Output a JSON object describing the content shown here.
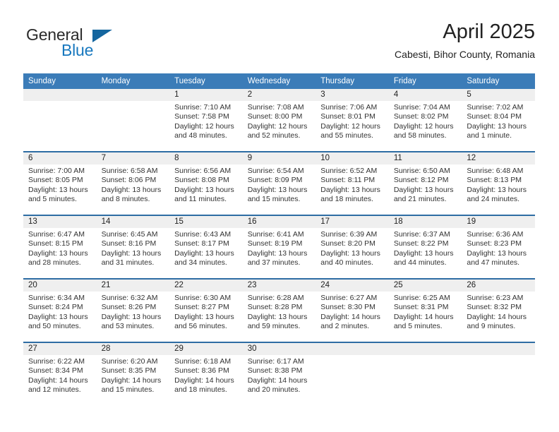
{
  "brand": {
    "name_part1": "General",
    "name_part2": "Blue",
    "triangle_color": "#15669f",
    "blue_color": "#1878be"
  },
  "header": {
    "title": "April 2025",
    "subtitle": "Cabesti, Bihor County, Romania"
  },
  "theme": {
    "header_blue": "#3b7cb8",
    "row_border_blue": "#2e6da4",
    "daynum_band_gray": "#efefef",
    "text_color": "#222222"
  },
  "weekday_headers": [
    "Sunday",
    "Monday",
    "Tuesday",
    "Wednesday",
    "Thursday",
    "Friday",
    "Saturday"
  ],
  "weeks": [
    [
      {
        "day": "",
        "sunrise": "",
        "sunset": "",
        "daylight_line1": "",
        "daylight_line2": "",
        "empty": true
      },
      {
        "day": "",
        "sunrise": "",
        "sunset": "",
        "daylight_line1": "",
        "daylight_line2": "",
        "empty": true
      },
      {
        "day": "1",
        "sunrise": "Sunrise: 7:10 AM",
        "sunset": "Sunset: 7:58 PM",
        "daylight_line1": "Daylight: 12 hours",
        "daylight_line2": "and 48 minutes."
      },
      {
        "day": "2",
        "sunrise": "Sunrise: 7:08 AM",
        "sunset": "Sunset: 8:00 PM",
        "daylight_line1": "Daylight: 12 hours",
        "daylight_line2": "and 52 minutes."
      },
      {
        "day": "3",
        "sunrise": "Sunrise: 7:06 AM",
        "sunset": "Sunset: 8:01 PM",
        "daylight_line1": "Daylight: 12 hours",
        "daylight_line2": "and 55 minutes."
      },
      {
        "day": "4",
        "sunrise": "Sunrise: 7:04 AM",
        "sunset": "Sunset: 8:02 PM",
        "daylight_line1": "Daylight: 12 hours",
        "daylight_line2": "and 58 minutes."
      },
      {
        "day": "5",
        "sunrise": "Sunrise: 7:02 AM",
        "sunset": "Sunset: 8:04 PM",
        "daylight_line1": "Daylight: 13 hours",
        "daylight_line2": "and 1 minute."
      }
    ],
    [
      {
        "day": "6",
        "sunrise": "Sunrise: 7:00 AM",
        "sunset": "Sunset: 8:05 PM",
        "daylight_line1": "Daylight: 13 hours",
        "daylight_line2": "and 5 minutes."
      },
      {
        "day": "7",
        "sunrise": "Sunrise: 6:58 AM",
        "sunset": "Sunset: 8:06 PM",
        "daylight_line1": "Daylight: 13 hours",
        "daylight_line2": "and 8 minutes."
      },
      {
        "day": "8",
        "sunrise": "Sunrise: 6:56 AM",
        "sunset": "Sunset: 8:08 PM",
        "daylight_line1": "Daylight: 13 hours",
        "daylight_line2": "and 11 minutes."
      },
      {
        "day": "9",
        "sunrise": "Sunrise: 6:54 AM",
        "sunset": "Sunset: 8:09 PM",
        "daylight_line1": "Daylight: 13 hours",
        "daylight_line2": "and 15 minutes."
      },
      {
        "day": "10",
        "sunrise": "Sunrise: 6:52 AM",
        "sunset": "Sunset: 8:11 PM",
        "daylight_line1": "Daylight: 13 hours",
        "daylight_line2": "and 18 minutes."
      },
      {
        "day": "11",
        "sunrise": "Sunrise: 6:50 AM",
        "sunset": "Sunset: 8:12 PM",
        "daylight_line1": "Daylight: 13 hours",
        "daylight_line2": "and 21 minutes."
      },
      {
        "day": "12",
        "sunrise": "Sunrise: 6:48 AM",
        "sunset": "Sunset: 8:13 PM",
        "daylight_line1": "Daylight: 13 hours",
        "daylight_line2": "and 24 minutes."
      }
    ],
    [
      {
        "day": "13",
        "sunrise": "Sunrise: 6:47 AM",
        "sunset": "Sunset: 8:15 PM",
        "daylight_line1": "Daylight: 13 hours",
        "daylight_line2": "and 28 minutes."
      },
      {
        "day": "14",
        "sunrise": "Sunrise: 6:45 AM",
        "sunset": "Sunset: 8:16 PM",
        "daylight_line1": "Daylight: 13 hours",
        "daylight_line2": "and 31 minutes."
      },
      {
        "day": "15",
        "sunrise": "Sunrise: 6:43 AM",
        "sunset": "Sunset: 8:17 PM",
        "daylight_line1": "Daylight: 13 hours",
        "daylight_line2": "and 34 minutes."
      },
      {
        "day": "16",
        "sunrise": "Sunrise: 6:41 AM",
        "sunset": "Sunset: 8:19 PM",
        "daylight_line1": "Daylight: 13 hours",
        "daylight_line2": "and 37 minutes."
      },
      {
        "day": "17",
        "sunrise": "Sunrise: 6:39 AM",
        "sunset": "Sunset: 8:20 PM",
        "daylight_line1": "Daylight: 13 hours",
        "daylight_line2": "and 40 minutes."
      },
      {
        "day": "18",
        "sunrise": "Sunrise: 6:37 AM",
        "sunset": "Sunset: 8:22 PM",
        "daylight_line1": "Daylight: 13 hours",
        "daylight_line2": "and 44 minutes."
      },
      {
        "day": "19",
        "sunrise": "Sunrise: 6:36 AM",
        "sunset": "Sunset: 8:23 PM",
        "daylight_line1": "Daylight: 13 hours",
        "daylight_line2": "and 47 minutes."
      }
    ],
    [
      {
        "day": "20",
        "sunrise": "Sunrise: 6:34 AM",
        "sunset": "Sunset: 8:24 PM",
        "daylight_line1": "Daylight: 13 hours",
        "daylight_line2": "and 50 minutes."
      },
      {
        "day": "21",
        "sunrise": "Sunrise: 6:32 AM",
        "sunset": "Sunset: 8:26 PM",
        "daylight_line1": "Daylight: 13 hours",
        "daylight_line2": "and 53 minutes."
      },
      {
        "day": "22",
        "sunrise": "Sunrise: 6:30 AM",
        "sunset": "Sunset: 8:27 PM",
        "daylight_line1": "Daylight: 13 hours",
        "daylight_line2": "and 56 minutes."
      },
      {
        "day": "23",
        "sunrise": "Sunrise: 6:28 AM",
        "sunset": "Sunset: 8:28 PM",
        "daylight_line1": "Daylight: 13 hours",
        "daylight_line2": "and 59 minutes."
      },
      {
        "day": "24",
        "sunrise": "Sunrise: 6:27 AM",
        "sunset": "Sunset: 8:30 PM",
        "daylight_line1": "Daylight: 14 hours",
        "daylight_line2": "and 2 minutes."
      },
      {
        "day": "25",
        "sunrise": "Sunrise: 6:25 AM",
        "sunset": "Sunset: 8:31 PM",
        "daylight_line1": "Daylight: 14 hours",
        "daylight_line2": "and 5 minutes."
      },
      {
        "day": "26",
        "sunrise": "Sunrise: 6:23 AM",
        "sunset": "Sunset: 8:32 PM",
        "daylight_line1": "Daylight: 14 hours",
        "daylight_line2": "and 9 minutes."
      }
    ],
    [
      {
        "day": "27",
        "sunrise": "Sunrise: 6:22 AM",
        "sunset": "Sunset: 8:34 PM",
        "daylight_line1": "Daylight: 14 hours",
        "daylight_line2": "and 12 minutes."
      },
      {
        "day": "28",
        "sunrise": "Sunrise: 6:20 AM",
        "sunset": "Sunset: 8:35 PM",
        "daylight_line1": "Daylight: 14 hours",
        "daylight_line2": "and 15 minutes."
      },
      {
        "day": "29",
        "sunrise": "Sunrise: 6:18 AM",
        "sunset": "Sunset: 8:36 PM",
        "daylight_line1": "Daylight: 14 hours",
        "daylight_line2": "and 18 minutes."
      },
      {
        "day": "30",
        "sunrise": "Sunrise: 6:17 AM",
        "sunset": "Sunset: 8:38 PM",
        "daylight_line1": "Daylight: 14 hours",
        "daylight_line2": "and 20 minutes."
      },
      {
        "day": "",
        "sunrise": "",
        "sunset": "",
        "daylight_line1": "",
        "daylight_line2": "",
        "empty": true
      },
      {
        "day": "",
        "sunrise": "",
        "sunset": "",
        "daylight_line1": "",
        "daylight_line2": "",
        "empty": true
      },
      {
        "day": "",
        "sunrise": "",
        "sunset": "",
        "daylight_line1": "",
        "daylight_line2": "",
        "empty": true
      }
    ]
  ]
}
